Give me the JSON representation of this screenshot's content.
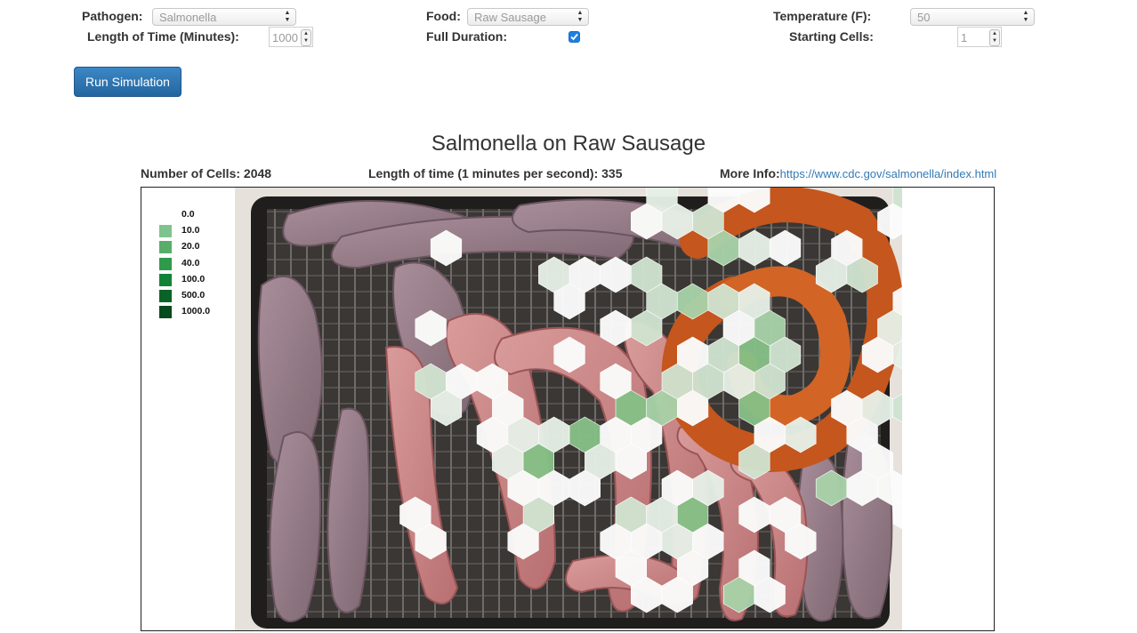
{
  "controls": {
    "pathogen": {
      "label": "Pathogen:",
      "value": "Salmonella"
    },
    "food": {
      "label": "Food:",
      "value": "Raw Sausage"
    },
    "temperature": {
      "label": "Temperature (F):",
      "value": "50"
    },
    "length_of_time": {
      "label": "Length of Time (Minutes):",
      "value": "1000"
    },
    "full_duration": {
      "label": "Full Duration:",
      "checked": true
    },
    "starting_cells": {
      "label": "Starting Cells:",
      "value": "1"
    },
    "run_button": "Run Simulation"
  },
  "simulation": {
    "title": "Salmonella on Raw Sausage",
    "cells_label": "Number of Cells:",
    "cells_value": "2048",
    "time_label": "Length of time (1 minutes per second):",
    "time_value": "335",
    "more_info_label": "More Info:",
    "more_info_link": "https://www.cdc.gov/salmonella/index.html"
  },
  "legend": [
    {
      "label": "0.0",
      "color": "#ffffff"
    },
    {
      "label": "10.0",
      "color": "#7fc38d"
    },
    {
      "label": "20.0",
      "color": "#59ad6a"
    },
    {
      "label": "40.0",
      "color": "#2f9a4c"
    },
    {
      "label": "100.0",
      "color": "#128236"
    },
    {
      "label": "500.0",
      "color": "#0a6326"
    },
    {
      "label": "1000.0",
      "color": "#074a1b"
    }
  ],
  "colors": {
    "link": "#337ab7",
    "button": "#2a73b0",
    "hex_level_0": "#fbfcfb",
    "hex_level_1": "#e6efe6",
    "hex_level_2": "#cfe3cf",
    "hex_level_3": "#a8d1a8",
    "hex_level_4": "#86bf86"
  },
  "image": {
    "subject": "raw sausages on a wire rack"
  },
  "hex_cells": [
    [
      0,
      14,
      1
    ],
    [
      1,
      14,
      1
    ],
    [
      0,
      16,
      0
    ],
    [
      0,
      17,
      0
    ],
    [
      0,
      22,
      2
    ],
    [
      0,
      23,
      2
    ],
    [
      1,
      13,
      0
    ],
    [
      1,
      15,
      2
    ],
    [
      1,
      21,
      0
    ],
    [
      1,
      22,
      0
    ],
    [
      2,
      7,
      0
    ],
    [
      2,
      16,
      3
    ],
    [
      2,
      17,
      1
    ],
    [
      2,
      18,
      0
    ],
    [
      2,
      20,
      0
    ],
    [
      3,
      10,
      1
    ],
    [
      3,
      11,
      0
    ],
    [
      3,
      12,
      0
    ],
    [
      3,
      13,
      2
    ],
    [
      3,
      19,
      1
    ],
    [
      3,
      20,
      2
    ],
    [
      3,
      24,
      0
    ],
    [
      4,
      11,
      0
    ],
    [
      4,
      14,
      2
    ],
    [
      4,
      15,
      3
    ],
    [
      4,
      16,
      2
    ],
    [
      4,
      17,
      1
    ],
    [
      4,
      22,
      0
    ],
    [
      4,
      25,
      0
    ],
    [
      5,
      6,
      0
    ],
    [
      5,
      12,
      0
    ],
    [
      5,
      13,
      2
    ],
    [
      5,
      16,
      0
    ],
    [
      5,
      17,
      3
    ],
    [
      5,
      21,
      1
    ],
    [
      5,
      23,
      0
    ],
    [
      5,
      24,
      0
    ],
    [
      6,
      11,
      0
    ],
    [
      6,
      15,
      0
    ],
    [
      6,
      16,
      2
    ],
    [
      6,
      17,
      4
    ],
    [
      6,
      18,
      2
    ],
    [
      6,
      21,
      0
    ],
    [
      6,
      22,
      1
    ],
    [
      6,
      23,
      1
    ],
    [
      6,
      24,
      1
    ],
    [
      7,
      6,
      2
    ],
    [
      7,
      7,
      0
    ],
    [
      7,
      8,
      0
    ],
    [
      7,
      12,
      0
    ],
    [
      7,
      14,
      2
    ],
    [
      7,
      15,
      2
    ],
    [
      7,
      16,
      1
    ],
    [
      7,
      17,
      2
    ],
    [
      7,
      22,
      0
    ],
    [
      7,
      23,
      2
    ],
    [
      7,
      24,
      1
    ],
    [
      8,
      7,
      1
    ],
    [
      8,
      9,
      0
    ],
    [
      8,
      13,
      4
    ],
    [
      8,
      14,
      3
    ],
    [
      8,
      15,
      0
    ],
    [
      8,
      17,
      4
    ],
    [
      8,
      20,
      0
    ],
    [
      8,
      21,
      1
    ],
    [
      8,
      22,
      2
    ],
    [
      8,
      24,
      0
    ],
    [
      9,
      8,
      0
    ],
    [
      9,
      9,
      1
    ],
    [
      9,
      10,
      1
    ],
    [
      9,
      11,
      4
    ],
    [
      9,
      12,
      0
    ],
    [
      9,
      13,
      0
    ],
    [
      9,
      17,
      0
    ],
    [
      9,
      18,
      1
    ],
    [
      9,
      20,
      0
    ],
    [
      10,
      9,
      1
    ],
    [
      10,
      10,
      4
    ],
    [
      10,
      12,
      1
    ],
    [
      10,
      13,
      0
    ],
    [
      10,
      17,
      2
    ],
    [
      10,
      21,
      0
    ],
    [
      11,
      9,
      0
    ],
    [
      11,
      10,
      0
    ],
    [
      11,
      11,
      0
    ],
    [
      11,
      14,
      0
    ],
    [
      11,
      15,
      1
    ],
    [
      11,
      19,
      3
    ],
    [
      11,
      20,
      0
    ],
    [
      11,
      21,
      0
    ],
    [
      12,
      6,
      0
    ],
    [
      12,
      10,
      2
    ],
    [
      12,
      13,
      2
    ],
    [
      12,
      14,
      1
    ],
    [
      12,
      15,
      4
    ],
    [
      12,
      17,
      0
    ],
    [
      12,
      18,
      0
    ],
    [
      12,
      22,
      0
    ],
    [
      13,
      6,
      0
    ],
    [
      13,
      9,
      0
    ],
    [
      13,
      12,
      0
    ],
    [
      13,
      13,
      0
    ],
    [
      13,
      14,
      1
    ],
    [
      13,
      15,
      0
    ],
    [
      13,
      18,
      0
    ],
    [
      14,
      13,
      0
    ],
    [
      14,
      15,
      0
    ],
    [
      14,
      17,
      0
    ],
    [
      15,
      13,
      0
    ],
    [
      15,
      14,
      0
    ],
    [
      15,
      16,
      3
    ],
    [
      15,
      17,
      0
    ]
  ]
}
